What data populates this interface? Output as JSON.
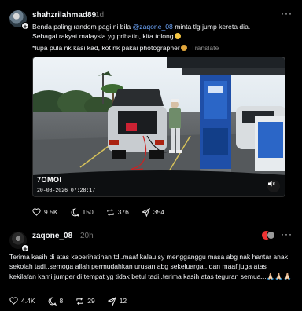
{
  "post1": {
    "username": "shahzrilahmad89",
    "time": "1d",
    "text_before_mention": "Benda paling random pagi ni bila ",
    "mention": "@zaqone_08",
    "text_after_mention": " minta tlg jump kereta dia.",
    "line2": "Sebagai rakyat malaysia yg prihatin, kita tolong",
    "line3": "*lupa pula nk kasi kad, kot nk pakai photographer",
    "translate": "Translate",
    "video": {
      "brand": "7OMOI",
      "timestamp": "20-08-2026  07:28:17",
      "mute_icon": "speaker-muted-icon"
    },
    "actions": {
      "likes": "9.5K",
      "comments": "150",
      "reposts": "376",
      "shares": "354"
    }
  },
  "post2": {
    "username": "zaqone_08",
    "time": "20h",
    "text": "Terima kasih di atas keperihatinan td..maaf kalau sy mengganggu masa abg nak hantar anak sekolah tadi..semoga allah permudahkan urusan abg sekeluarga...dan maaf juga atas kekilafan kami jumper di tempat yg tidak betul tadi..terima kasih atas teguran semua...🙏🏻🙏🏻🙏🏻",
    "actions": {
      "likes": "4.4K",
      "comments": "8",
      "reposts": "29",
      "shares": "12"
    }
  },
  "colors": {
    "background": "#000000",
    "text": "#f3f5f7",
    "muted": "#777777",
    "mention": "#6fa8ff"
  }
}
